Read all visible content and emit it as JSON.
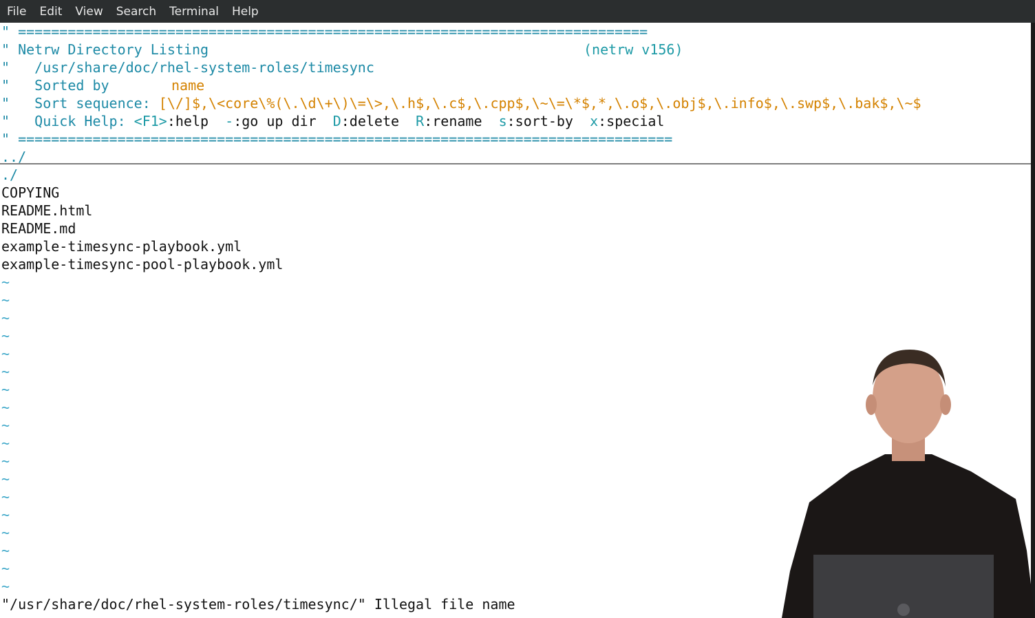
{
  "menubar": {
    "items": [
      "File",
      "Edit",
      "View",
      "Search",
      "Terminal",
      "Help"
    ]
  },
  "netrw": {
    "rule_top": "\" ============================================================================",
    "title_quote": "\" ",
    "title": "Netrw Directory Listing",
    "version": "(netrw v156)",
    "path_quote": "\"   ",
    "path": "/usr/share/doc/rhel-system-roles/timesync",
    "sorted_quote": "\"   ",
    "sorted_label": "Sorted by",
    "sorted_value": "name",
    "sortseq_quote": "\"   ",
    "sortseq_label": "Sort sequence:",
    "sortseq_value": "[\\/]$,\\<core\\%(\\.\\d\\+\\)\\=\\>,\\.h$,\\.c$,\\.cpp$,\\~\\=\\*$,*,\\.o$,\\.obj$,\\.info$,\\.swp$,\\.bak$,\\~$",
    "help_quote": "\"   ",
    "help_label": "Quick Help:",
    "help_items": [
      {
        "key": "<F1>",
        "action": ":help"
      },
      {
        "key": "-",
        "action": ":go up dir"
      },
      {
        "key": "D",
        "action": ":delete"
      },
      {
        "key": "R",
        "action": ":rename"
      },
      {
        "key": "s",
        "action": ":sort-by"
      },
      {
        "key": "x",
        "action": ":special"
      }
    ],
    "rule_bottom": "\" ==============================================================================="
  },
  "entries": [
    "../",
    "./",
    "COPYING",
    "README.html",
    "README.md",
    "example-timesync-playbook.yml",
    "example-timesync-pool-playbook.yml"
  ],
  "tilde": "~",
  "status_message": "\"/usr/share/doc/rhel-system-roles/timesync/\" Illegal file name",
  "colors": {
    "menubar_bg": "#2b2e2f",
    "comment": "#1d8aa6",
    "highlight": "#d48200"
  }
}
